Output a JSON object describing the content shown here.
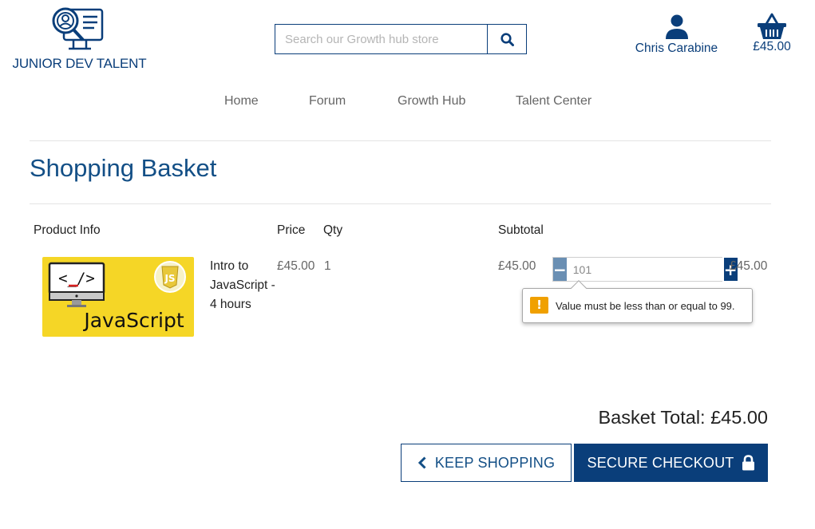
{
  "brand": {
    "name": "JUNIOR DEV TALENT",
    "logo_icon": "person-magnifier-monitor-icon",
    "color": "#0a3e7a"
  },
  "search": {
    "placeholder": "Search our Growth hub store",
    "value": "",
    "button_icon": "search-icon"
  },
  "user": {
    "name": "Chris Carabine",
    "icon": "user-icon"
  },
  "basket_widget": {
    "total": "£45.00",
    "icon": "basket-icon"
  },
  "nav": {
    "items": [
      {
        "label": "Home"
      },
      {
        "label": "Forum"
      },
      {
        "label": "Growth Hub"
      },
      {
        "label": "Talent Center"
      }
    ]
  },
  "page": {
    "title": "Shopping Basket"
  },
  "table": {
    "headers": {
      "product_info": "Product Info",
      "price": "Price",
      "qty": "Qty",
      "subtotal": "Subtotal"
    },
    "rows": [
      {
        "image": {
          "code_glyph": "<_/>",
          "badge": "JS",
          "caption": "JavaScript"
        },
        "name": "Intro to JavaScript - 4 hours",
        "price": "£45.00",
        "qty": "1",
        "subtotal": "£45.00",
        "qty_input_value": "101",
        "line_total": "£45.00"
      }
    ]
  },
  "validation": {
    "message": "Value must be less than or equal to 99.",
    "icon": "warning-icon",
    "color": "#f0a000"
  },
  "summary": {
    "total": "Basket Total: £45.00"
  },
  "actions": {
    "keep_shopping": "KEEP SHOPPING",
    "secure_checkout": "SECURE CHECKOUT"
  },
  "colors": {
    "primary": "#0a3e7a",
    "title": "#134f86",
    "stepper_minus": "#6a8fb3",
    "product_bg": "#f5d626"
  }
}
